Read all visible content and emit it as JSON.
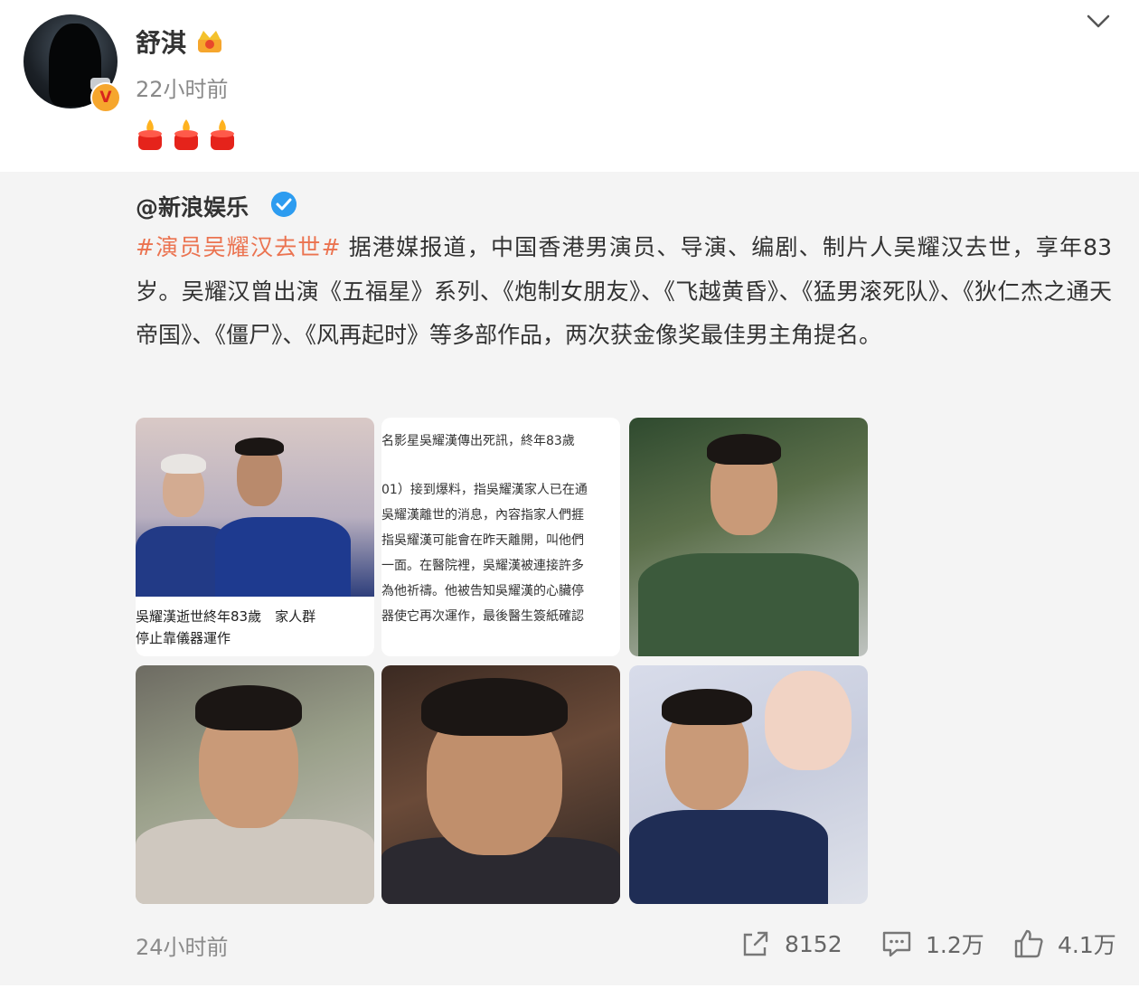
{
  "post": {
    "username": "舒淇",
    "time": "22小时前",
    "user_verified_badge": "V",
    "crown_icon": "crown-icon",
    "candles_icon": "candle-icon",
    "candle_count": 3
  },
  "repost": {
    "source": "@新浪娱乐",
    "hashtag": "#演员吴耀汉去世#",
    "text": " 据港媒报道，中国香港男演员、导演、编剧、制片人吴耀汉去世，享年83岁。吴耀汉曾出演《五福星》系列、《炮制女朋友》、《飞越黄昏》、《猛男滚死队》、《狄仁杰之通天帝国》、《僵尸》、《风再起时》等多部作品，两次获金像奖最佳男主角提名。",
    "images": {
      "caption1_line1": "吳耀漢逝世終年83歲　家人群",
      "caption1_line2": "停止靠儀器運作",
      "news_lines": [
        "名影星吳耀漢傳出死訊，終年83歲",
        "",
        "01）接到爆料，指吳耀漢家人已在通",
        "吳耀漢離世的消息，內容指家人們捱",
        "指吳耀漢可能會在昨天離開，叫他們",
        "一面。在醫院裡，吳耀漢被連接許多",
        "為他祈禱。他被告知吳耀漢的心臟停",
        "器使它再次運作，最後醫生簽紙確認"
      ]
    }
  },
  "footer": {
    "time": "24小时前",
    "share_count": "8152",
    "comment_count": "1.2万",
    "like_count": "4.1万"
  },
  "colors": {
    "hashtag": "#eb7350",
    "verified_blue": "#2d9cf0",
    "badge_orange": "#f6a62d"
  }
}
